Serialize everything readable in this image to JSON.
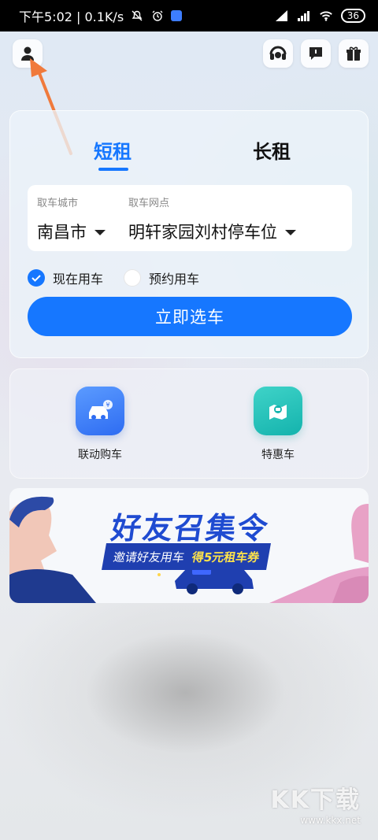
{
  "status_bar": {
    "time_speed": "下午5:02 | 0.1K/s",
    "battery": "36"
  },
  "header": {
    "profile_icon": "person-icon",
    "support_icon": "headset-icon",
    "message_icon": "chat-icon",
    "gift_icon": "gift-icon"
  },
  "booking": {
    "tabs": [
      {
        "label": "短租",
        "active": true
      },
      {
        "label": "长租",
        "active": false
      }
    ],
    "city_label": "取车城市",
    "city_value": "南昌市",
    "point_label": "取车网点",
    "point_value": "明轩家园刘村停车位",
    "options": [
      {
        "label": "现在用车",
        "selected": true
      },
      {
        "label": "预约用车",
        "selected": false
      }
    ],
    "cta_label": "立即选车"
  },
  "services": [
    {
      "label": "联动购车",
      "icon": "car-purchase-icon"
    },
    {
      "label": "特惠车",
      "icon": "discount-car-icon"
    }
  ],
  "banner": {
    "title": "好友召集令",
    "subtitle": "邀请好友用车",
    "highlight": "得5元租车券"
  },
  "watermark": {
    "main": "KK下载",
    "url": "www.kkx.net"
  },
  "colors": {
    "accent": "#1677ff",
    "arrow": "#f07a3c"
  }
}
